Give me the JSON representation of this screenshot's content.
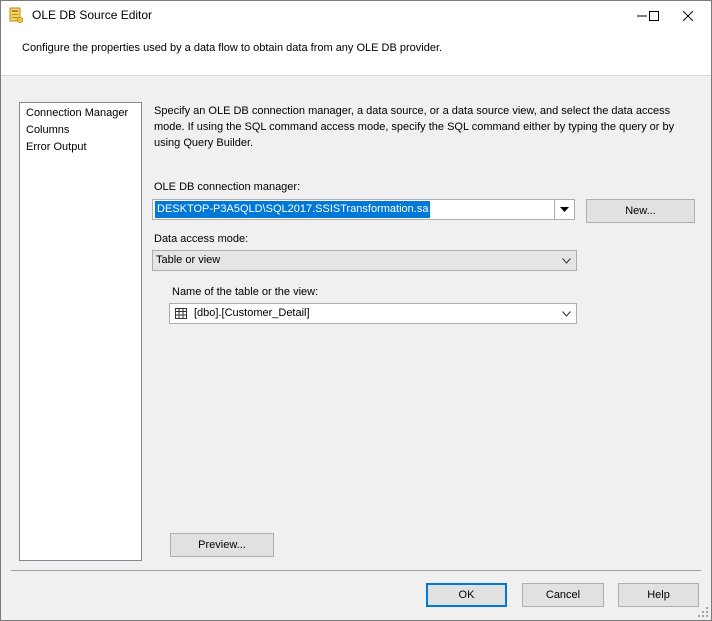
{
  "window": {
    "title": "OLE DB Source Editor",
    "minimize_glyph": "—",
    "maximize_glyph": "☐",
    "close_glyph": "✕"
  },
  "header": {
    "text": "Configure the properties used by a data flow to obtain data from any OLE DB provider."
  },
  "nav": {
    "items": [
      {
        "label": "Connection Manager"
      },
      {
        "label": "Columns"
      },
      {
        "label": "Error Output"
      }
    ]
  },
  "main": {
    "description": "Specify an OLE DB connection manager, a data source, or a data source view, and select the data access mode. If using the SQL command access mode, specify the SQL command either by typing the query or by using Query Builder.",
    "connection_label": "OLE DB connection manager:",
    "connection_value": "DESKTOP-P3A5QLD\\SQL2017.SSISTransformation.sa",
    "new_button": "New...",
    "access_mode_label": "Data access mode:",
    "access_mode_value": "Table or view",
    "table_label": "Name of the table or the view:",
    "table_value": "[dbo].[Customer_Detail]",
    "preview_button": "Preview..."
  },
  "footer": {
    "ok": "OK",
    "cancel": "Cancel",
    "help": "Help"
  },
  "colors": {
    "accent": "#0078d7",
    "window_bg": "#f0f0f0"
  }
}
